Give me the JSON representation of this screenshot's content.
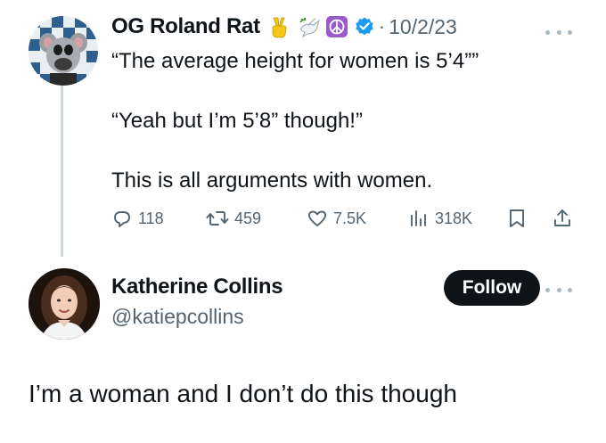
{
  "tweet1": {
    "display_name": "OG Roland Rat",
    "name_emojis": [
      "victory-hand-icon",
      "dove-icon",
      "peace-symbol-icon"
    ],
    "verified": true,
    "separator": "·",
    "date": "10/2/23",
    "lines": [
      "“The average height for women is 5’4””",
      "“Yeah but I’m 5’8” though!”",
      "This is all arguments with women."
    ],
    "metrics": {
      "replies": "118",
      "reposts": "459",
      "likes": "7.5K",
      "views": "318K"
    }
  },
  "tweet2": {
    "display_name": "Katherine Collins",
    "handle": "@katiepcollins",
    "follow_label": "Follow",
    "text": "I’m a woman and I don’t do this though"
  },
  "colors": {
    "text_primary": "#0f1419",
    "text_secondary": "#536471",
    "verified_blue": "#1d9bf0",
    "peace_purple": "#9b59c9",
    "thread_line": "#cfd9de",
    "follow_bg": "#0f1419"
  }
}
